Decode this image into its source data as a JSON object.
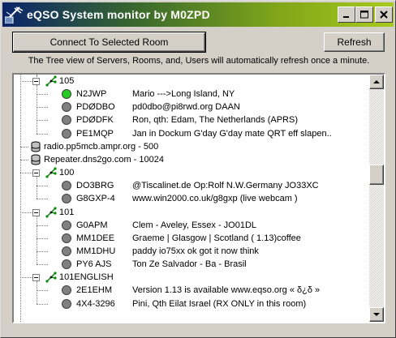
{
  "window": {
    "title": "eQSO System monitor by M0ZPD"
  },
  "toolbar": {
    "connect_label": "Connect To Selected Room",
    "refresh_label": "Refresh"
  },
  "info_text": "The Tree view of Servers, Rooms, and, Users will automatically refresh once a minute.",
  "tree": {
    "items": [
      {
        "kind": "room",
        "label": "105"
      },
      {
        "kind": "user",
        "status": "green",
        "callsign": "N2JWP",
        "info": "Mario --->Long Island, NY"
      },
      {
        "kind": "user",
        "status": "grey",
        "callsign": "PDØDBO",
        "info": "pd0dbo@pi8rwd.org   DAAN"
      },
      {
        "kind": "user",
        "status": "grey",
        "callsign": "PDØDFK",
        "info": "Ron, qth: Edam,  The Netherlands  (APRS)"
      },
      {
        "kind": "user",
        "status": "grey",
        "callsign": "PE1MQP",
        "info": "Jan in          Dockum G'day G'day mate QRT eff slapen.."
      },
      {
        "kind": "server",
        "label": "radio.pp5mcb.ampr.org - 500"
      },
      {
        "kind": "server",
        "label": "Repeater.dns2go.com - 10024"
      },
      {
        "kind": "room",
        "label": "100"
      },
      {
        "kind": "user",
        "status": "grey",
        "callsign": "DO3BRG",
        "info": "@Tiscalinet.de    Op:Rolf   N.W.Germany   JO33XC"
      },
      {
        "kind": "user",
        "status": "grey",
        "callsign": "G8GXP-4",
        "info": "www.win2000.co.uk/g8gxp  (live webcam )"
      },
      {
        "kind": "room",
        "label": "101"
      },
      {
        "kind": "user",
        "status": "grey",
        "callsign": "G0APM",
        "info": "Clem - Aveley, Essex - JO01DL"
      },
      {
        "kind": "user",
        "status": "grey",
        "callsign": "MM1DEE",
        "info": "Graeme |  Glasgow | Scotland ( 1.13)coffee"
      },
      {
        "kind": "user",
        "status": "grey",
        "callsign": "MM1DHU",
        "info": "paddy io75xx ok got it now think"
      },
      {
        "kind": "user",
        "status": "grey",
        "callsign": "PY6 AJS",
        "info": "Ton Ze Salvador - Ba - Brasil"
      },
      {
        "kind": "room",
        "label": "101ENGLISH"
      },
      {
        "kind": "user",
        "status": "grey",
        "callsign": "2E1EHM",
        "info": "Version 1.13 is available www.eqso.org « δ¿δ »"
      },
      {
        "kind": "user",
        "status": "grey",
        "callsign": "4X4-3296",
        "info": "Pini, Qth Eilat Israel (RX ONLY in this room)"
      }
    ]
  },
  "colors": {
    "online": "#22cc22",
    "offline": "#808080"
  }
}
